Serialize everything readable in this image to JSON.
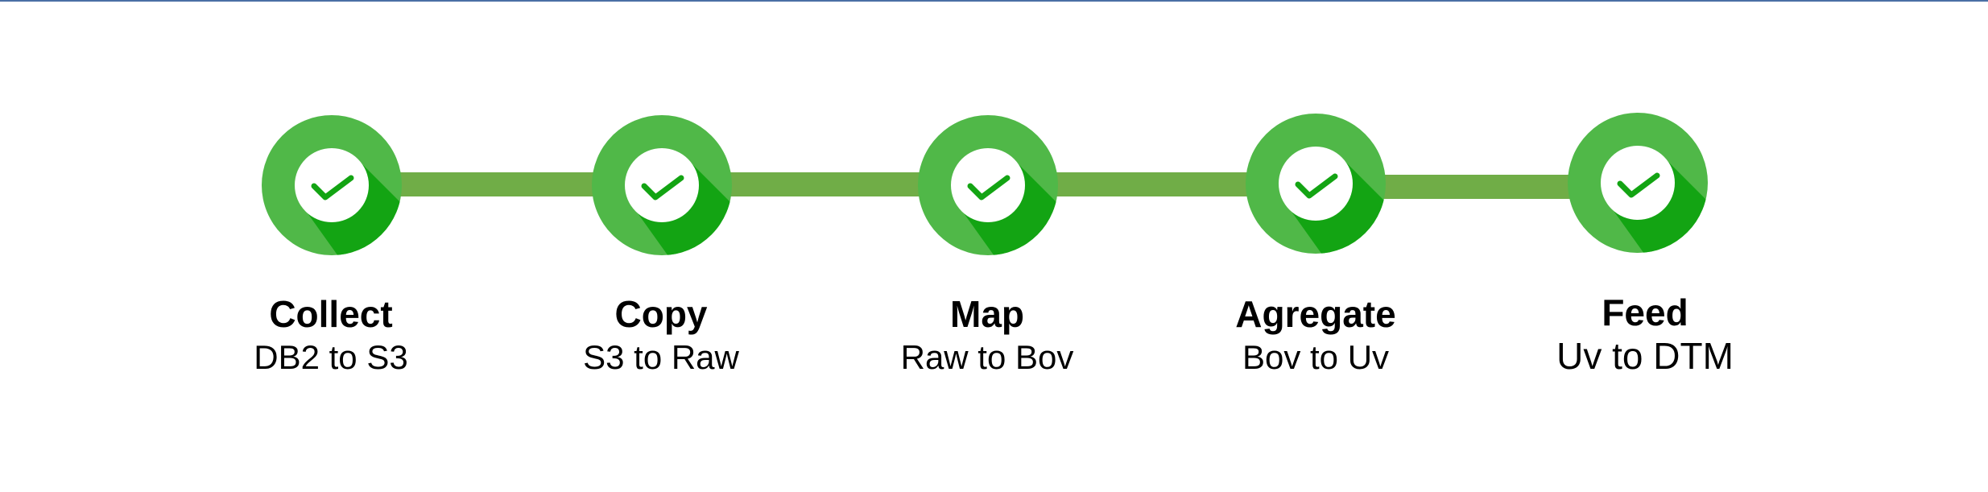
{
  "colors": {
    "rule": "#4a6fa5",
    "connector": "#70ad47",
    "circle_light": "#50b848",
    "circle_shadow": "#13a413",
    "check": "#13a413",
    "inner": "#ffffff"
  },
  "steps": [
    {
      "title": "Collect",
      "subtitle": "DB2 to S3",
      "status": "done",
      "icon": "check-icon"
    },
    {
      "title": "Copy",
      "subtitle": "S3 to Raw",
      "status": "done",
      "icon": "check-icon"
    },
    {
      "title": "Map",
      "subtitle": "Raw to Bov",
      "status": "done",
      "icon": "check-icon"
    },
    {
      "title": "Agregate",
      "subtitle": "Bov to Uv",
      "status": "done",
      "icon": "check-icon"
    },
    {
      "title": "Feed",
      "subtitle": "Uv to DTM",
      "status": "done",
      "icon": "check-icon"
    }
  ]
}
